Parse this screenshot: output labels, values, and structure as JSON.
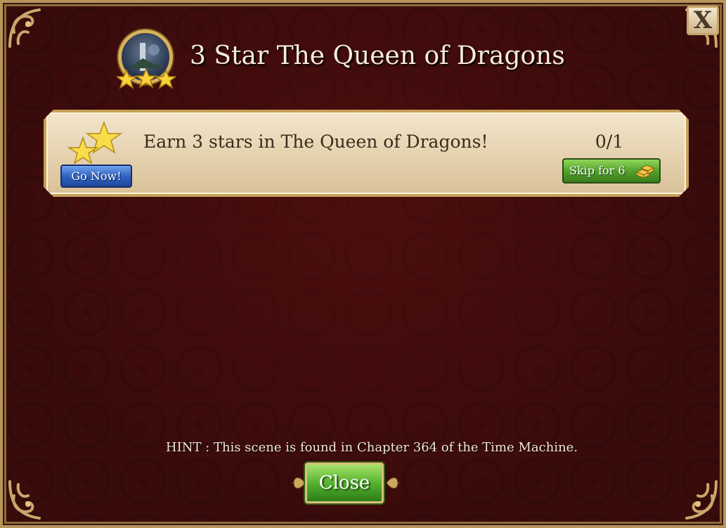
{
  "dialog": {
    "title": "3 Star The Queen of Dragons",
    "close_x": "X"
  },
  "task": {
    "description": "Earn 3 stars in The Queen of Dragons!",
    "progress": "0/1",
    "go_label": "Go Now!",
    "skip_label": "Skip for 6",
    "skip_cost": 6,
    "cost_icon": "gold-bars-icon"
  },
  "hint": "HINT : This scene is found in Chapter 364 of the Time Machine.",
  "close_label": "Close",
  "colors": {
    "background": "#3a0b0b",
    "gold_border": "#c79f58",
    "panel": "#efdfc1",
    "go_button": "#2c5fbf",
    "green_button": "#4e9e2a"
  }
}
